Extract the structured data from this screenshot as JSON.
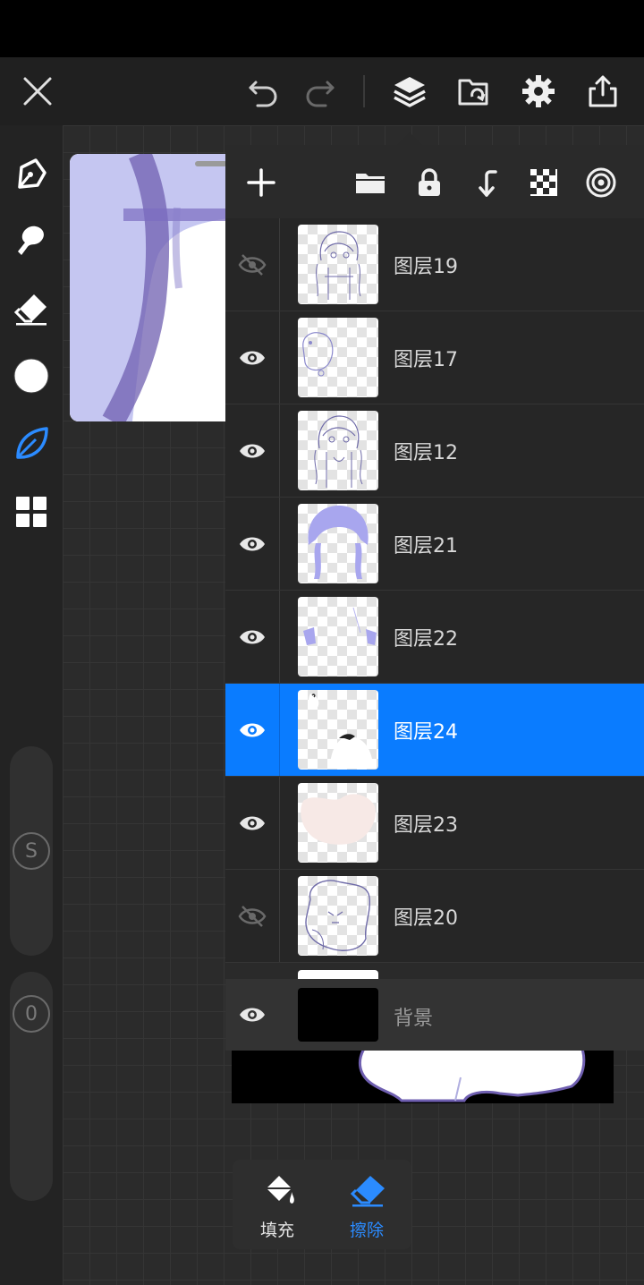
{
  "top_bar": {
    "close_icon": "close-icon",
    "undo_icon": "undo-icon",
    "redo_icon": "redo-icon",
    "layers_icon": "layers-icon",
    "gallery_icon": "gallery-icon",
    "settings_icon": "gear-icon",
    "share_icon": "share-icon"
  },
  "left_tools": [
    {
      "name": "pen-tool-icon"
    },
    {
      "name": "smudge-tool-icon"
    },
    {
      "name": "eraser-tool-icon"
    },
    {
      "name": "color-picker"
    },
    {
      "name": "leaf-brush-icon",
      "active": true
    },
    {
      "name": "grid-menu-icon"
    }
  ],
  "sliders": {
    "size_label": "S",
    "opacity_label": "0"
  },
  "layer_toolbar": {
    "add": "plus-icon",
    "folder": "folder-icon",
    "lock": "lock-icon",
    "merge_down": "merge-down-icon",
    "transparency": "checker-icon",
    "target": "target-icon"
  },
  "layers": [
    {
      "name": "图层19",
      "visible": false,
      "selected": false
    },
    {
      "name": "图层17",
      "visible": true,
      "selected": false
    },
    {
      "name": "图层12",
      "visible": true,
      "selected": false
    },
    {
      "name": "图层21",
      "visible": true,
      "selected": false
    },
    {
      "name": "图层22",
      "visible": true,
      "selected": false
    },
    {
      "name": "图层24",
      "visible": true,
      "selected": true
    },
    {
      "name": "图层23",
      "visible": true,
      "selected": false
    },
    {
      "name": "图层20",
      "visible": false,
      "selected": false
    }
  ],
  "background_layer": {
    "name": "背景",
    "visible": true
  },
  "bottom_tools": {
    "fill_label": "填充",
    "erase_label": "擦除",
    "active": "erase"
  },
  "colors": {
    "accent": "#0a7cff",
    "current_color": "#ffffff",
    "line_purple": "#6f5fb0",
    "fill_lavender": "#c5c6f1"
  }
}
